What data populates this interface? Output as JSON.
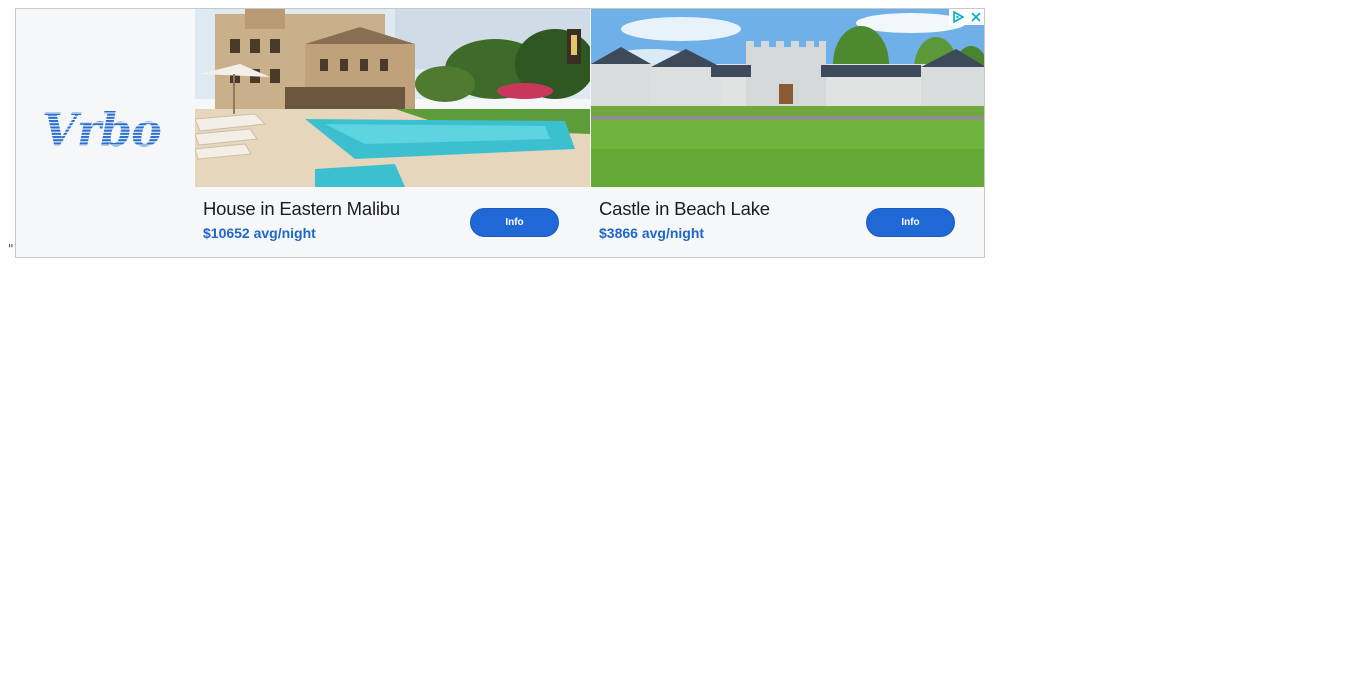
{
  "page": {
    "stray_text": "\""
  },
  "ad": {
    "brand": {
      "logo_text": "Vrbo",
      "color": "#2a6fd0"
    },
    "adchoices": {
      "icon": "adchoices-play-icon",
      "close_icon": "close-icon",
      "color": "#00aecd"
    },
    "listings": [
      {
        "title": "House in Eastern Malibu",
        "price": "$10652 avg/night",
        "button_label": "Info",
        "photo": "villa-with-pool-photo"
      },
      {
        "title": "Castle in Beach Lake",
        "price": "$3866 avg/night",
        "button_label": "Info",
        "photo": "white-castle-lawn-photo"
      }
    ],
    "colors": {
      "button": "#1f68d6",
      "price": "#1f66cc",
      "panel_bg": "#f5f7f9"
    }
  }
}
